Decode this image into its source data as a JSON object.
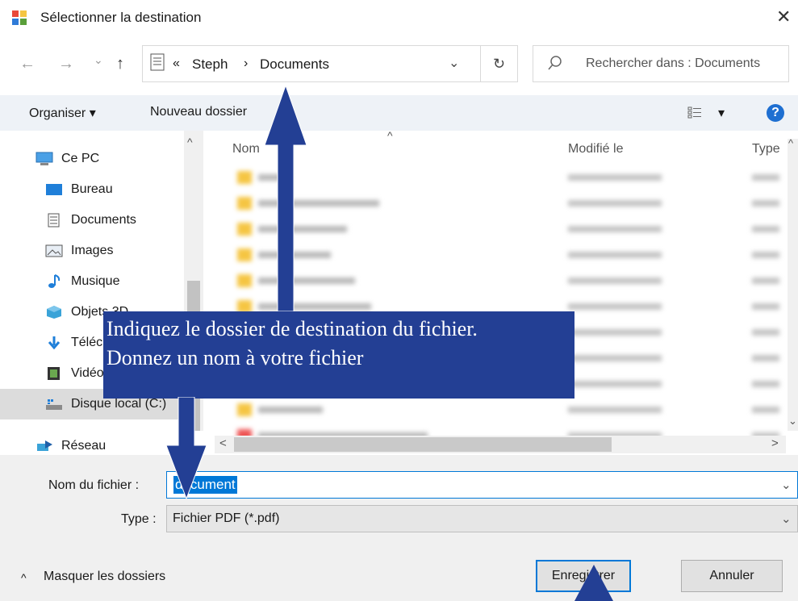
{
  "window": {
    "title": "Sélectionner la destination",
    "close_label": "✕"
  },
  "nav": {
    "back": "←",
    "forward": "→",
    "recent": "⌄",
    "up": "↑",
    "breadcrumb_prefix": "«",
    "breadcrumb": [
      "Steph",
      "Documents"
    ],
    "breadcrumb_sep": "›",
    "address_dropdown": "⌄",
    "refresh": "↻",
    "search_placeholder": "Rechercher dans : Documents"
  },
  "toolbar": {
    "organise": "Organiser ▾",
    "new_folder": "Nouveau dossier",
    "view_dropdown": "▾",
    "help": "?"
  },
  "sidebar": {
    "items": [
      {
        "label": "Ce PC",
        "icon": "computer-icon"
      },
      {
        "label": "Bureau",
        "icon": "desktop-icon"
      },
      {
        "label": "Documents",
        "icon": "documents-icon"
      },
      {
        "label": "Images",
        "icon": "images-icon"
      },
      {
        "label": "Musique",
        "icon": "music-icon"
      },
      {
        "label": "Objets 3D",
        "icon": "objects3d-icon"
      },
      {
        "label": "Téléchargements",
        "icon": "download-icon"
      },
      {
        "label": "Vidéos",
        "icon": "video-icon"
      },
      {
        "label": "Disque local (C:)",
        "icon": "disk-icon"
      },
      {
        "label": "Réseau",
        "icon": "network-icon"
      }
    ]
  },
  "filelist": {
    "columns": [
      "Nom",
      "Modifié le",
      "Type"
    ],
    "sort_indicator": "^",
    "scroll_left": "<",
    "scroll_right": ">",
    "scroll_up": "^",
    "scroll_down": "⌄",
    "scroll_up_left": "^"
  },
  "form": {
    "filename_label": "Nom du fichier :",
    "filename_value": "document",
    "type_label": "Type :",
    "type_value": "Fichier PDF (*.pdf)",
    "dropdown_glyph": "⌄"
  },
  "footer": {
    "hide_folders": "Masquer les dossiers",
    "hide_glyph": "^",
    "save": "Enregistrer",
    "cancel": "Annuler"
  },
  "overlay": {
    "line1": "Indiquez le dossier de destination du fichier.",
    "line2": "Donnez un nom à votre fichier"
  },
  "colors": {
    "accent": "#0078d7",
    "callout": "#233f94",
    "folder": "#f5c542"
  }
}
